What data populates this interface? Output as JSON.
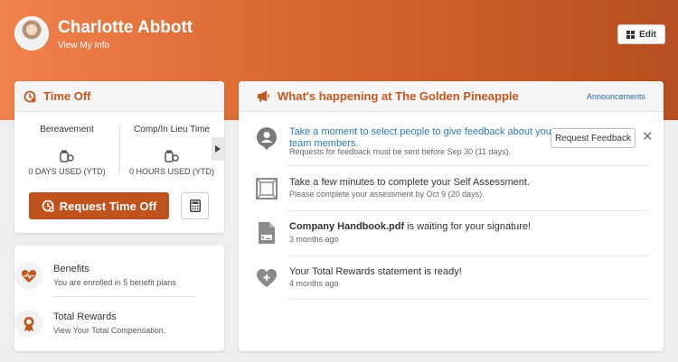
{
  "header": {
    "user_name": "Charlotte Abbott",
    "view_info": "View My Info",
    "edit_label": "Edit"
  },
  "time_off": {
    "title": "Time Off",
    "categories": [
      {
        "name": "Bereavement",
        "used": "0 DAYS USED (YTD)"
      },
      {
        "name": "Comp/In Lieu Time",
        "used": "0 HOURS USED (YTD)"
      }
    ],
    "request_label": "Request Time Off"
  },
  "benefits": [
    {
      "title": "Benefits",
      "subtitle": "You are enrolled in 5 benefit plans",
      "icon": "heart-pulse-icon"
    },
    {
      "title": "Total Rewards",
      "subtitle": "View Your Total Compensation.",
      "icon": "award-ribbon-icon"
    }
  ],
  "feed": {
    "title": "What's happening at The Golden Pineapple",
    "announcements_link": "Announcements",
    "items": [
      {
        "line1": "Take a moment to select people to give feedback about your",
        "line2": "team members.",
        "sub": "Requests for feedback must be sent before Sep 30 (11 days).",
        "action": "Request Feedback",
        "icon": "person-feedback-icon"
      },
      {
        "text": "Take a few minutes to complete your Self Assessment.",
        "sub": "Please complete your assessment by Oct 9 (20 days).",
        "icon": "framed-picture-icon"
      },
      {
        "bold": "Company Handbook.pdf",
        "text": " is waiting for your signature!",
        "sub": "3 months ago",
        "icon": "signature-document-icon"
      },
      {
        "text": "Your Total Rewards statement is ready!",
        "sub": "4 months ago",
        "icon": "heart-plus-icon"
      }
    ]
  },
  "colors": {
    "accent": "#c4571f",
    "button": "#bf521d",
    "link": "#2d7ab0"
  }
}
